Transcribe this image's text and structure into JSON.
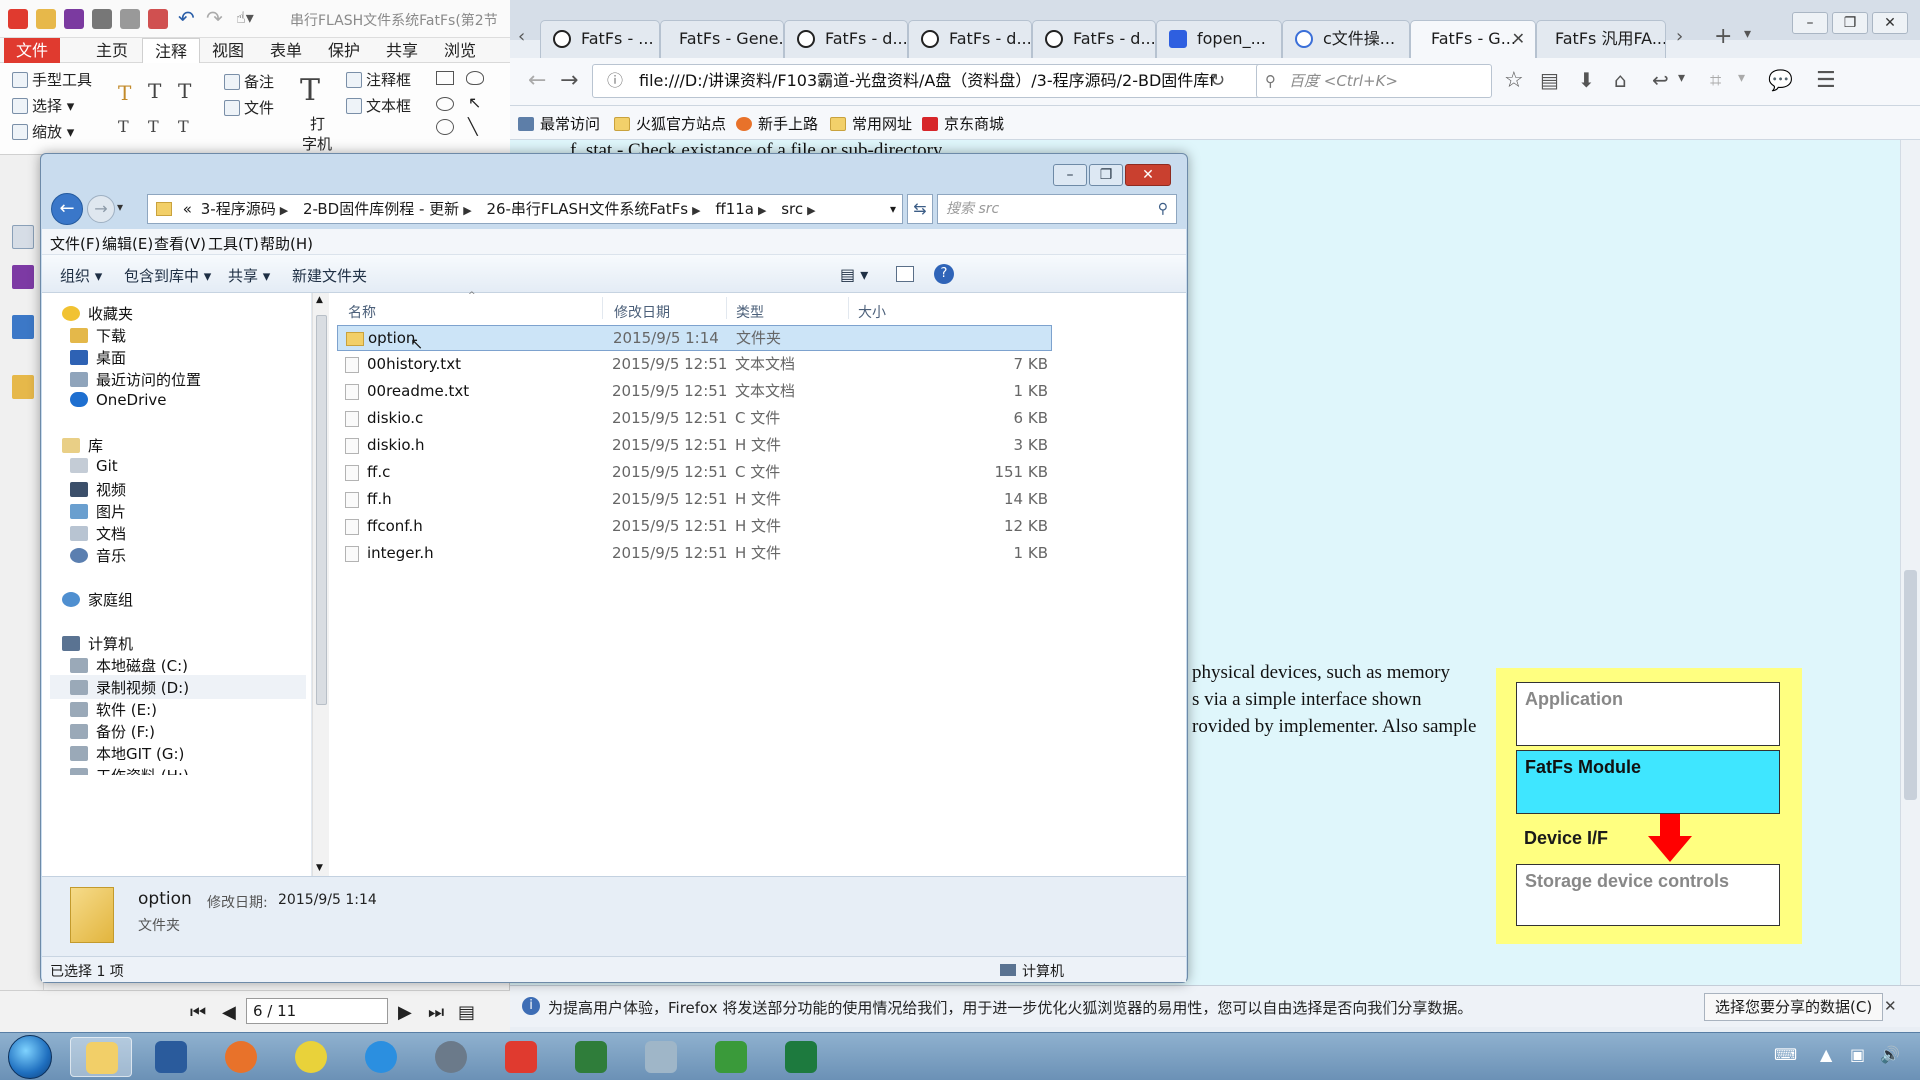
{
  "pdf_app": {
    "title": "串行FLASH文件系统FatFs(第2节",
    "menus": [
      "文件",
      "主页",
      "注释",
      "视图",
      "表单",
      "保护",
      "共享",
      "浏览"
    ],
    "ribbon": {
      "hand_tool": "手型工具",
      "select": "选择",
      "zoom": "缩放",
      "note": "备注",
      "file": "文件",
      "typewriter_line1": "打",
      "typewriter_line2": "字机",
      "annotation_box": "注释框",
      "text_box": "文本框"
    },
    "nav": {
      "page_value": "6 / 11"
    }
  },
  "firefox": {
    "tabs": [
      {
        "label": "FatFs - ...",
        "icon": "fatfs-favicon"
      },
      {
        "label": "FatFs - Gene...",
        "icon": "none"
      },
      {
        "label": "FatFs - d...",
        "icon": "fatfs-favicon"
      },
      {
        "label": "FatFs - d...",
        "icon": "fatfs-favicon"
      },
      {
        "label": "FatFs - d...",
        "icon": "fatfs-favicon"
      },
      {
        "label": "fopen_...",
        "icon": "baidu-favicon"
      },
      {
        "label": "c文件操...",
        "icon": "c-favicon"
      },
      {
        "label": "FatFs - G...",
        "icon": "none",
        "active": true
      },
      {
        "label": "FatFs 汎用FA...",
        "icon": "none"
      }
    ],
    "url": "file:///D:/讲课资料/F103霸道-光盘资料/A盘（资料盘）/3-程序源码/2-BD固件库f",
    "search_placeholder": "百度 <Ctrl+K>",
    "bookmarks": [
      "最常访问",
      "火狐官方站点",
      "新手上路",
      "常用网址",
      "京东商城"
    ],
    "doc_text_top": "f_stat - Check existance of a file or sub-directory",
    "doc_lines": [
      "physical devices, such as memory",
      "s via a simple interface shown",
      "rovided by implementer. Also sample"
    ],
    "diagram": {
      "application": "Application",
      "fatfs_module": "FatFs Module",
      "device_if": "Device I/F",
      "storage": "Storage device controls"
    },
    "notice_text": "为提高用户体验，Firefox 将发送部分功能的使用情况给我们，用于进一步优化火狐浏览器的易用性，您可以自由选择是否向我们分享数据。",
    "notice_button": "选择您要分享的数据(C)"
  },
  "explorer": {
    "breadcrumb": [
      "«",
      "3-程序源码",
      "2-BD固件库例程 - 更新",
      "26-串行FLASH文件系统FatFs",
      "ff11a",
      "src"
    ],
    "search_placeholder": "搜索 src",
    "menus": [
      "文件(F)",
      "编辑(E)",
      "查看(V)",
      "工具(T)",
      "帮助(H)"
    ],
    "toolbar": [
      "组织 ▾",
      "包含到库中 ▾",
      "共享 ▾",
      "新建文件夹"
    ],
    "nav": {
      "favorites": "收藏夹",
      "downloads": "下载",
      "desktop": "桌面",
      "recent": "最近访问的位置",
      "onedrive": "OneDrive",
      "libraries": "库",
      "git": "Git",
      "videos": "视频",
      "pictures": "图片",
      "documents": "文档",
      "music": "音乐",
      "homegroup": "家庭组",
      "computer": "计算机",
      "drive_c": "本地磁盘 (C:)",
      "drive_d": "录制视频 (D:)",
      "drive_e": "软件 (E:)",
      "drive_f": "备份 (F:)",
      "drive_g": "本地GIT (G:)",
      "drive_h": "工作资料 (H:)"
    },
    "columns": [
      "名称",
      "修改日期",
      "类型",
      "大小"
    ],
    "files": [
      {
        "name": "option",
        "date": "2015/9/5 1:14",
        "type": "文件夹",
        "size": ""
      },
      {
        "name": "00history.txt",
        "date": "2015/9/5 12:51",
        "type": "文本文档",
        "size": "7 KB"
      },
      {
        "name": "00readme.txt",
        "date": "2015/9/5 12:51",
        "type": "文本文档",
        "size": "1 KB"
      },
      {
        "name": "diskio.c",
        "date": "2015/9/5 12:51",
        "type": "C 文件",
        "size": "6 KB"
      },
      {
        "name": "diskio.h",
        "date": "2015/9/5 12:51",
        "type": "H 文件",
        "size": "3 KB"
      },
      {
        "name": "ff.c",
        "date": "2015/9/5 12:51",
        "type": "C 文件",
        "size": "151 KB"
      },
      {
        "name": "ff.h",
        "date": "2015/9/5 12:51",
        "type": "H 文件",
        "size": "14 KB"
      },
      {
        "name": "ffconf.h",
        "date": "2015/9/5 12:51",
        "type": "H 文件",
        "size": "12 KB"
      },
      {
        "name": "integer.h",
        "date": "2015/9/5 12:51",
        "type": "H 文件",
        "size": "1 KB"
      }
    ],
    "details": {
      "name": "option",
      "date_label": "修改日期:",
      "date_value": "2015/9/5 1:14",
      "type": "文件夹"
    },
    "status_left": "已选择 1 项",
    "status_right": "计算机"
  },
  "colors": {
    "fatfs_module_fill": "#3fe6ff",
    "diagram_background": "#ffff80",
    "arrow": "#ff0000",
    "selection": "#cce4f7",
    "pdf_file_menu": "#e03a2f"
  }
}
